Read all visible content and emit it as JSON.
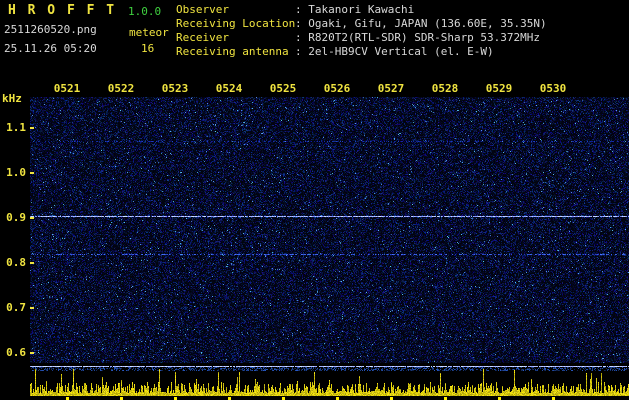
{
  "colors": {
    "background": "#000000",
    "accent_yellow": "#f0e440",
    "version_green": "#3fd03f",
    "text_white": "#d9d9d9",
    "spectrogram_blue": "#2233bb",
    "carrier_line_white": "#dce8ff",
    "level_line_blue": "#aebfff",
    "level_noise_yellow": "#e8d820"
  },
  "header": {
    "app_title": "H R O F F T",
    "version": "1.0.0",
    "file_name": "2511260520.png",
    "mode": "meteor",
    "datetime": "25.11.26 05:20",
    "count": "16",
    "meta": [
      {
        "label": "Observer",
        "value": ": Takanori Kawachi"
      },
      {
        "label": "Receiving Location",
        "value": ": Ogaki, Gifu, JAPAN (136.60E, 35.35N)"
      },
      {
        "label": "Receiver",
        "value": ": R820T2(RTL-SDR) SDR-Sharp 53.372MHz"
      },
      {
        "label": "Receiving antenna",
        "value": ": 2el-HB9CV Vertical (el. E-W)"
      }
    ]
  },
  "chart_data": {
    "type": "heatmap",
    "title": "HROFFT meteor-echo radio spectrogram 05:20-05:30",
    "ylabel": "kHz",
    "x_tick_labels": [
      "0521",
      "0522",
      "0523",
      "0524",
      "0525",
      "0526",
      "0527",
      "0528",
      "0529",
      "0530"
    ],
    "y_ticks": [
      1.1,
      1.0,
      0.9,
      0.8,
      0.7,
      0.6
    ],
    "y_range_khz": [
      0.58,
      1.17
    ],
    "x_range_time": [
      "05:20",
      "05:30"
    ],
    "carrier_lines": [
      {
        "khz": 0.902,
        "strength": "strong"
      },
      {
        "khz": 0.818,
        "strength": "medium"
      },
      {
        "khz": 1.068,
        "strength": "faint"
      }
    ],
    "background_texture": "dark blue random noise",
    "level_strip": {
      "description": "received signal level vs time with minute ticks",
      "top_line_color": "#aebfff",
      "noise_color": "#e8d820"
    }
  }
}
